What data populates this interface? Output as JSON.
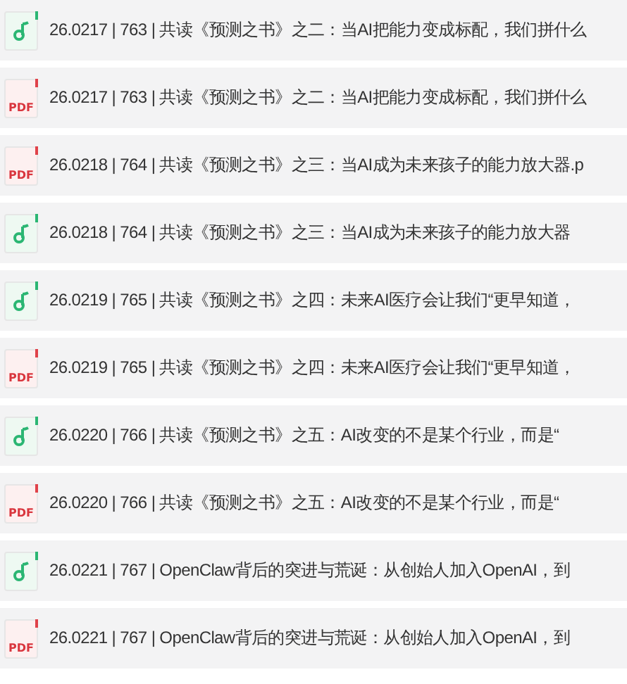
{
  "files": [
    {
      "kind": "audio",
      "name": "26.0217 | 763 | 共读《预测之书》之二：当AI把能力变成标配，我们拼什么"
    },
    {
      "kind": "pdf",
      "icon_text": "PDF",
      "name": "26.0217 | 763 | 共读《预测之书》之二：当AI把能力变成标配，我们拼什么"
    },
    {
      "kind": "pdf",
      "icon_text": "PDF",
      "name": "26.0218 | 764 | 共读《预测之书》之三：当AI成为未来孩子的能力放大器.p"
    },
    {
      "kind": "audio",
      "name": "26.0218 | 764 | 共读《预测之书》之三：当AI成为未来孩子的能力放大器"
    },
    {
      "kind": "audio",
      "name": "26.0219 | 765 | 共读《预测之书》之四：未来AI医疗会让我们“更早知道，"
    },
    {
      "kind": "pdf",
      "icon_text": "PDF",
      "name": "26.0219 | 765 | 共读《预测之书》之四：未来AI医疗会让我们“更早知道，"
    },
    {
      "kind": "audio",
      "name": "26.0220 | 766 | 共读《预测之书》之五：AI改变的不是某个行业，而是“"
    },
    {
      "kind": "pdf",
      "icon_text": "PDF",
      "name": "26.0220 | 766 | 共读《预测之书》之五：AI改变的不是某个行业，而是“"
    },
    {
      "kind": "audio",
      "name": "26.0221 | 767 | OpenClaw背后的突进与荒诞：从创始人加入OpenAI，到"
    },
    {
      "kind": "pdf",
      "icon_text": "PDF",
      "name": "26.0221 | 767 | OpenClaw背后的突进与荒诞：从创始人加入OpenAI，到"
    }
  ]
}
